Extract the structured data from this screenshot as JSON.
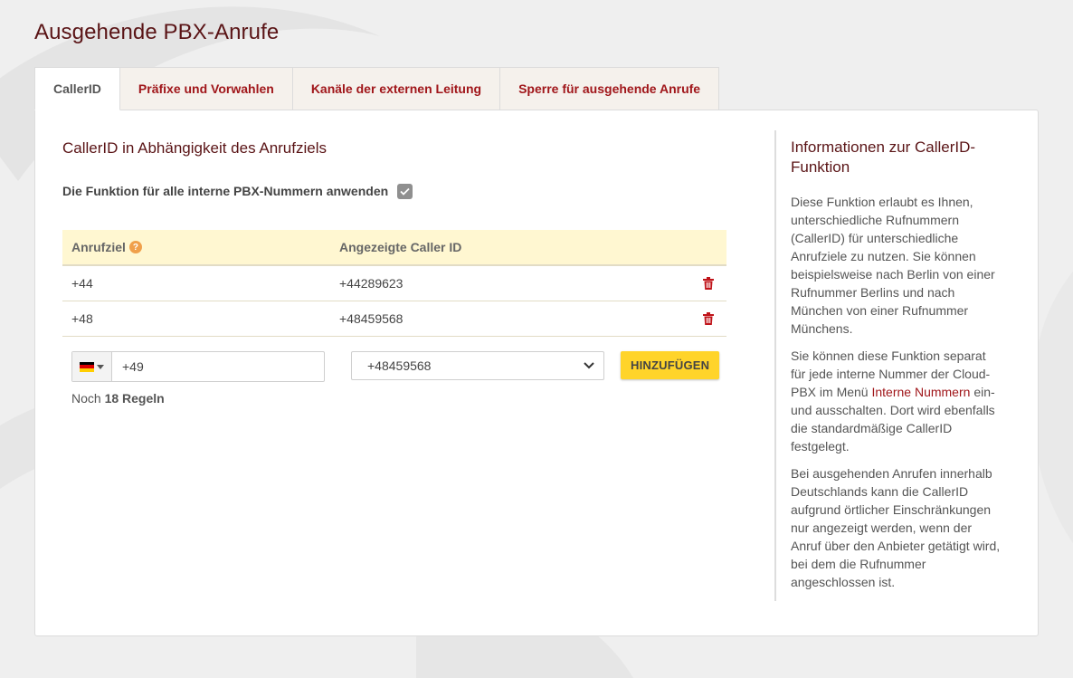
{
  "page": {
    "title": "Ausgehende PBX-Anrufe"
  },
  "tabs": [
    {
      "label": "CallerID",
      "active": true
    },
    {
      "label": "Präfixe und Vorwahlen",
      "active": false
    },
    {
      "label": "Kanäle der externen Leitung",
      "active": false
    },
    {
      "label": "Sperre für ausgehende Anrufe",
      "active": false
    }
  ],
  "main": {
    "section_title": "CallerID in Abhängigkeit des Anrufziels",
    "apply_all_label": "Die Funktion für alle interne PBX-Nummern anwenden",
    "apply_all_checked": true,
    "table": {
      "headers": {
        "target": "Anrufziel",
        "caller_id": "Angezeigte Caller ID"
      },
      "rows": [
        {
          "target": "+44",
          "caller_id": "+44289623"
        },
        {
          "target": "+48",
          "caller_id": "+48459568"
        }
      ]
    },
    "add_form": {
      "country_flag": "de-flag-icon",
      "phone_value": "+49",
      "select_value": "+48459568",
      "add_button": "HINZUFÜGEN"
    },
    "rules_left": {
      "prefix": "Noch",
      "count": "18 Regeln"
    }
  },
  "info": {
    "title": "Informationen zur CallerID-Funktion",
    "p1": "Diese Funktion erlaubt es Ihnen, unterschiedliche Rufnummern (CallerID) für unterschiedliche Anrufziele zu nutzen. Sie können beispielsweise nach Berlin von einer Rufnummer Berlins und nach München von einer Rufnummer Münchens.",
    "p2_before": "Sie können diese Funktion separat für jede interne Nummer der Cloud-PBX im Menü",
    "p2_link": "Interne Nummern",
    "p2_after": "ein- und ausschalten. Dort wird ebenfalls die standardmäßige CallerID festgelegt.",
    "p3": "Bei ausgehenden Anrufen innerhalb Deutschlands kann die CallerID aufgrund örtlicher Einschränkungen nur angezeigt werden, wenn der Anruf über den Anbieter getätigt wird, bei dem die Rufnummer angeschlossen ist."
  },
  "colors": {
    "brand_dark": "#5a1416",
    "link_red": "#a0161a",
    "header_yellow": "#fff7d1",
    "button_yellow": "#ffd42a",
    "help_orange": "#f0a04b"
  }
}
